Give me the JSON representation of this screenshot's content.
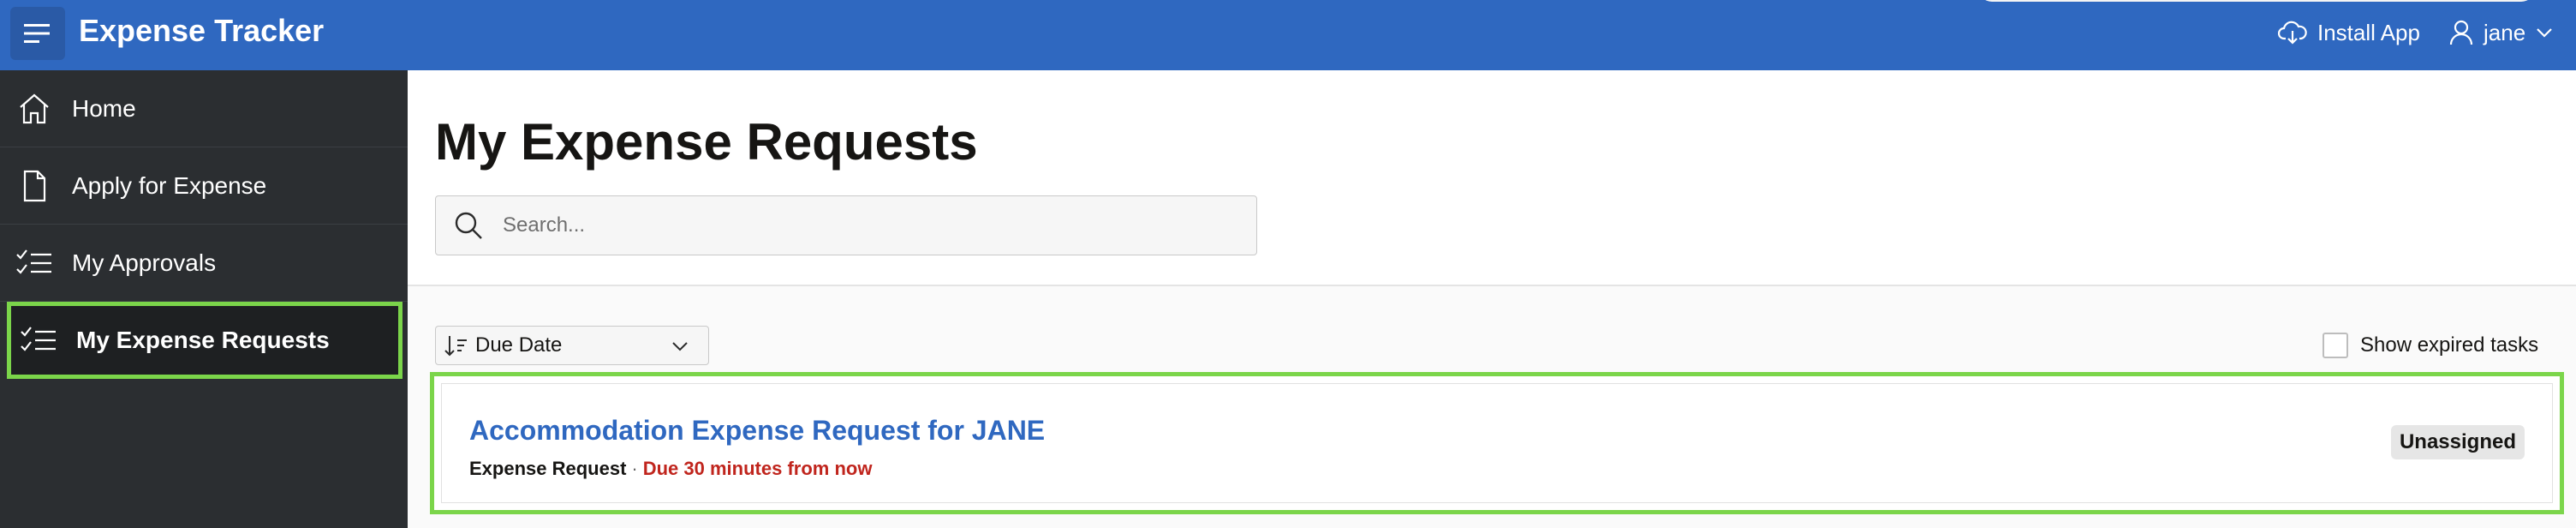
{
  "header": {
    "app_title": "Expense Tracker",
    "install_label": "Install App",
    "user_label": "jane",
    "colors": {
      "header_bg": "#2f68c0",
      "accent_green": "#7bd54a"
    }
  },
  "sidebar": {
    "items": [
      {
        "label": "Home",
        "icon": "home-icon"
      },
      {
        "label": "Apply for Expense",
        "icon": "document-icon"
      },
      {
        "label": "My Approvals",
        "icon": "checklist-icon"
      },
      {
        "label": "My Expense Requests",
        "icon": "checklist-icon",
        "active": true
      }
    ]
  },
  "main": {
    "page_title": "My Expense Requests",
    "search": {
      "placeholder": "Search..."
    },
    "sort": {
      "selected": "Due Date"
    },
    "show_expired_label": "Show expired tasks",
    "tasks": [
      {
        "title": "Accommodation Expense Request for JANE",
        "type": "Expense Request",
        "separator": "·",
        "due": "Due 30 minutes from now",
        "status": "Unassigned"
      }
    ]
  }
}
